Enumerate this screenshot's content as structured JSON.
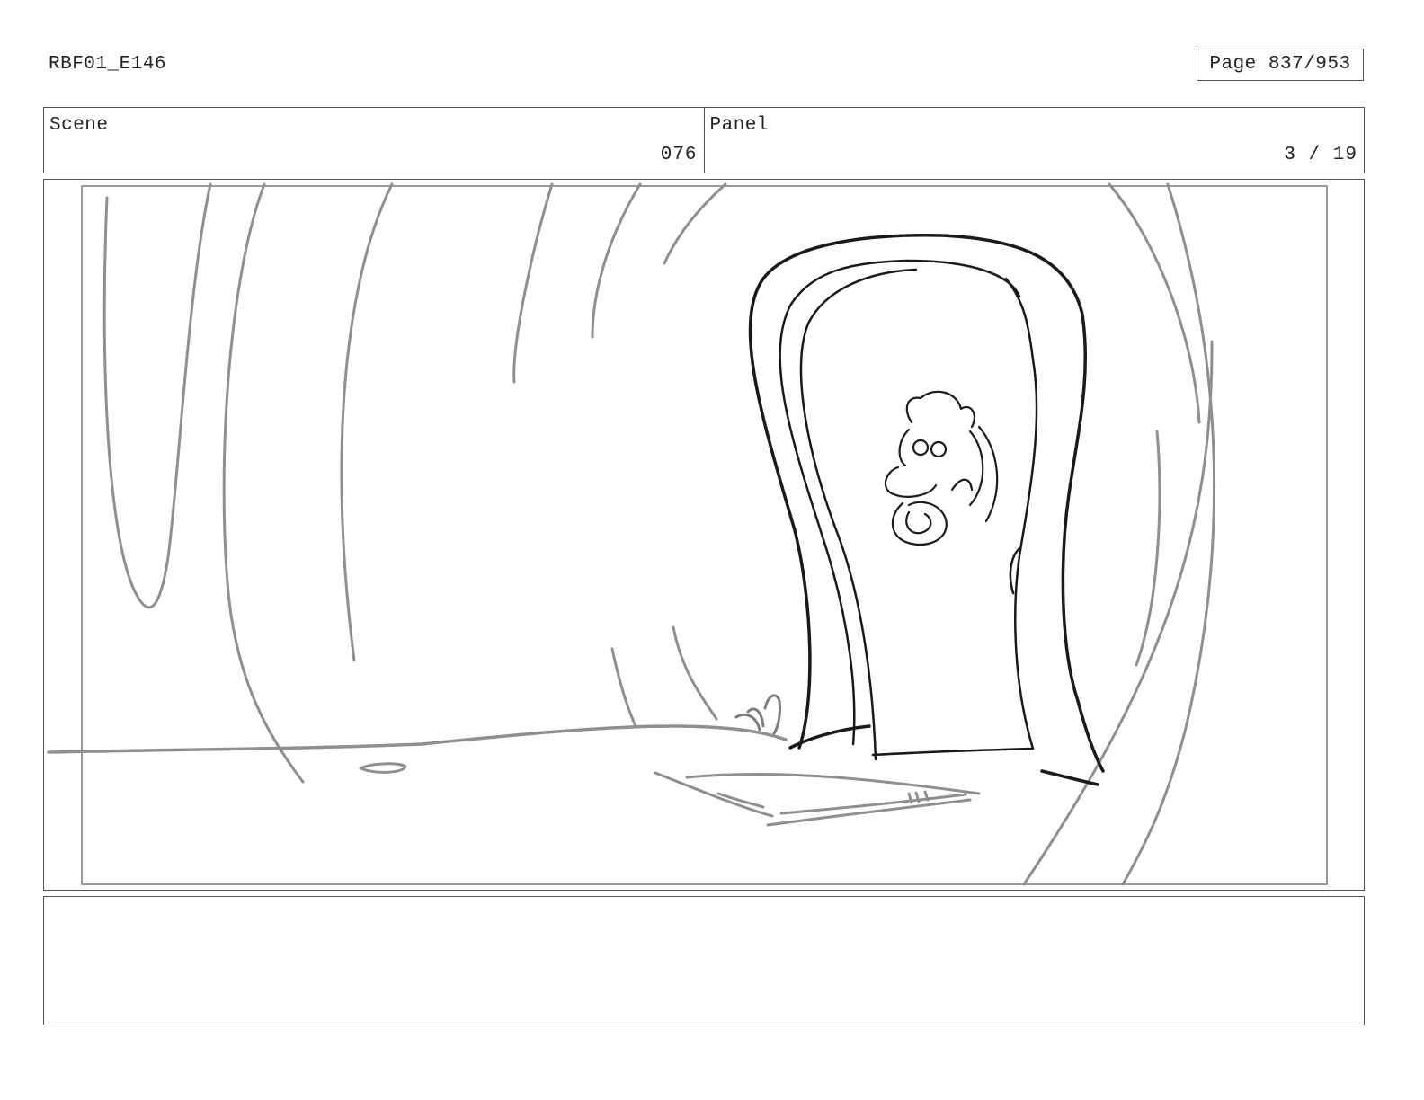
{
  "header": {
    "production_code": "RBF01_E146",
    "page_indicator": "Page 837/953"
  },
  "info": {
    "scene_label": "Scene",
    "scene_number": "076",
    "panel_label": "Panel",
    "panel_number": "3 / 19"
  },
  "panel": {
    "drawing": "storyboard-sketch"
  },
  "notes": {
    "text": ""
  }
}
